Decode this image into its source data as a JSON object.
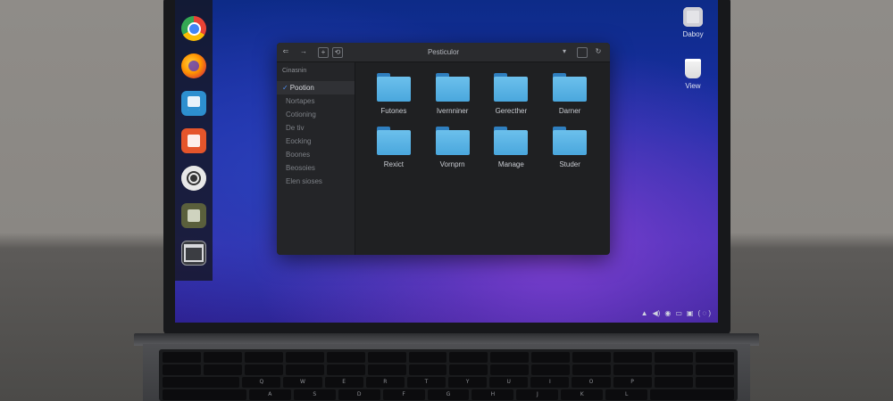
{
  "dock": {
    "items": [
      {
        "name": "chrome"
      },
      {
        "name": "firefox"
      },
      {
        "name": "files"
      },
      {
        "name": "software"
      },
      {
        "name": "settings"
      },
      {
        "name": "editor"
      },
      {
        "name": "window"
      }
    ]
  },
  "desktop": {
    "icons": [
      {
        "label": "Daboy",
        "icon": "trash-icon"
      },
      {
        "label": "View",
        "icon": "view-icon"
      }
    ]
  },
  "file_manager": {
    "title": "Pesticulor",
    "sidebar": {
      "header": "Cinasnin",
      "items": [
        {
          "label": "Pootion",
          "active": true
        },
        {
          "label": "Nortapes",
          "active": false
        },
        {
          "label": "Cotioning",
          "active": false
        },
        {
          "label": "De tiv",
          "active": false
        },
        {
          "label": "Eocking",
          "active": false
        },
        {
          "label": "Boones",
          "active": false
        },
        {
          "label": "Beosoies",
          "active": false
        },
        {
          "label": "Elen sioses",
          "active": false
        }
      ]
    },
    "folders": [
      {
        "label": "Futones"
      },
      {
        "label": "Ivernniner"
      },
      {
        "label": "Gerecther"
      },
      {
        "label": "Darner"
      },
      {
        "label": "Rexict"
      },
      {
        "label": "Vornprn"
      },
      {
        "label": "Manage"
      },
      {
        "label": "Studer"
      }
    ]
  },
  "keyboard": {
    "row2_keys": [
      "Q",
      "W",
      "E",
      "R",
      "T",
      "Y",
      "U",
      "I",
      "O",
      "P"
    ],
    "row3_keys": [
      "A",
      "S",
      "D",
      "F",
      "G",
      "H",
      "J",
      "K",
      "L"
    ]
  }
}
